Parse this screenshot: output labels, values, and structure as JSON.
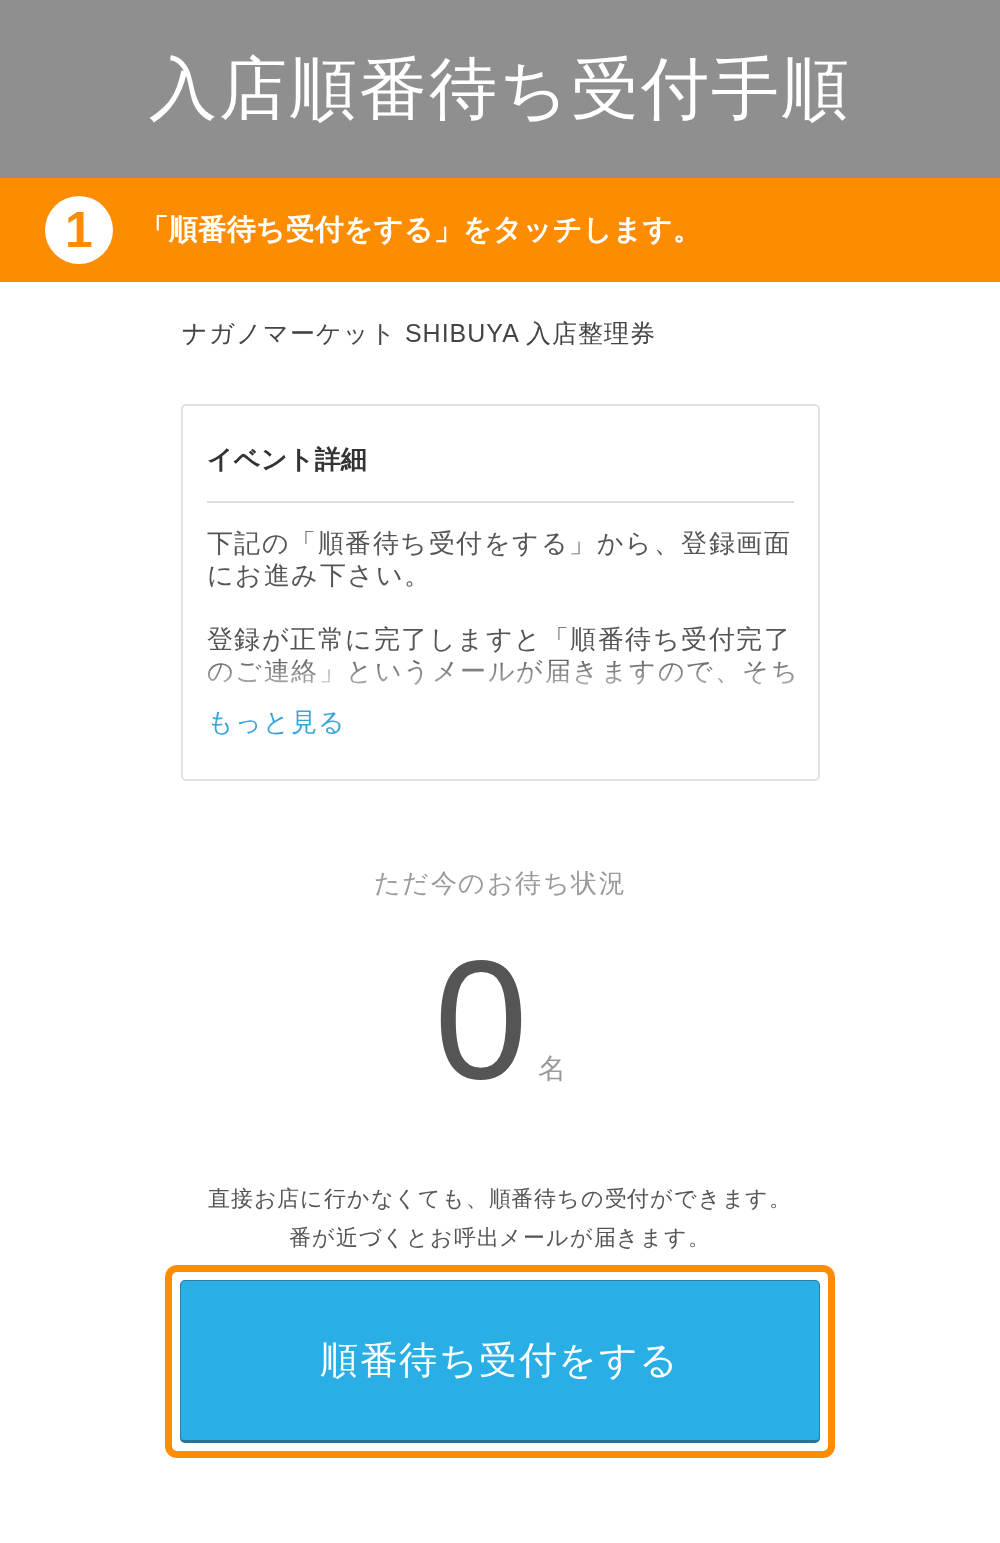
{
  "header": {
    "title": "入店順番待ち受付手順"
  },
  "step": {
    "number": "1",
    "text": "「順番待ち受付をする」をタッチします。"
  },
  "ticket_title": "ナガノマーケット SHIBUYA 入店整理券",
  "event_card": {
    "title": "イベント詳細",
    "paragraphs": [
      "下記の「順番待ち受付をする」から、登録画面にお進み下さい。",
      "登録が正常に完了しますと「順番待ち受付完了のご連絡」というメールが届きますので、そち"
    ],
    "more_link": "もっと見る"
  },
  "waiting": {
    "label": "ただ今のお待ち状況",
    "count": "0",
    "unit": "名"
  },
  "notes": [
    "直接お店に行かなくても、順番待ちの受付ができます。",
    "番が近づくとお呼出メールが届きます。"
  ],
  "action": {
    "label": "順番待ち受付をする",
    "highlighted": true
  }
}
